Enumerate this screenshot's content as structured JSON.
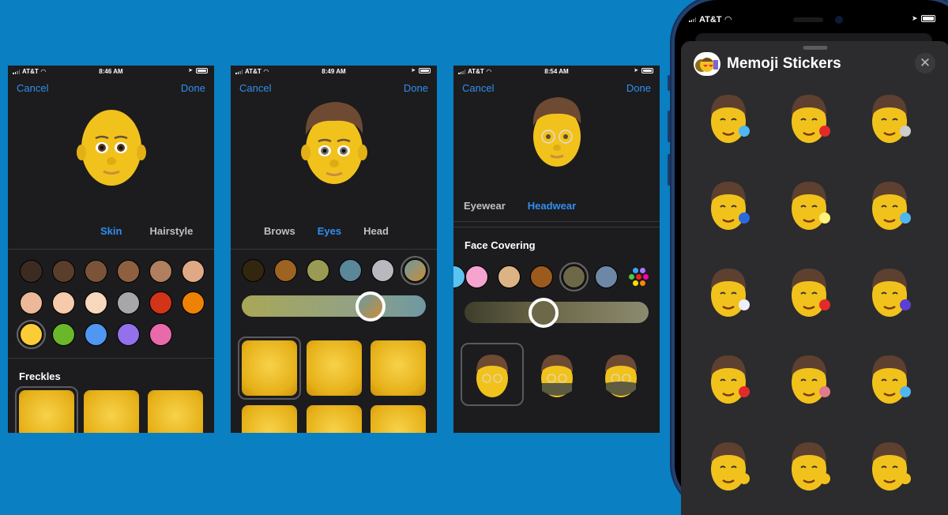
{
  "colors": {
    "background": "#0a7fc2",
    "accent": "#2f8ff0",
    "panel": "#1c1c1e",
    "sheet": "#2c2c2e"
  },
  "screens": [
    {
      "status": {
        "carrier": "AT&T",
        "time": "8:46 AM"
      },
      "nav": {
        "cancel": "Cancel",
        "done": "Done"
      },
      "avatar": "bald-memoji-face",
      "tabs": [
        {
          "label": "Skin",
          "active": true
        },
        {
          "label": "Hairstyle",
          "active": false
        }
      ],
      "swatches": [
        "#3d2b22",
        "#5b3d2c",
        "#7a5338",
        "#8e6040",
        "#b07f5e",
        "#dfa985",
        "#ebb998",
        "#f5cbab",
        "#f7d8bd",
        "#a7a7a7",
        "#d13418",
        "#ee8205",
        "#fbcc35",
        "#6ab72a",
        "#4f97f3",
        "#9470ea",
        "#e86aaa"
      ],
      "selected_swatch": 12,
      "section": "Freckles",
      "options": [
        "no-freckles",
        "light-freckles",
        "heavy-freckles"
      ],
      "selected_option": 0
    },
    {
      "status": {
        "carrier": "AT&T",
        "time": "8:49 AM"
      },
      "nav": {
        "cancel": "Cancel",
        "done": "Done"
      },
      "avatar": "memoji-with-hair-freckles",
      "tabs": [
        {
          "label": "Brows",
          "active": false
        },
        {
          "label": "Eyes",
          "active": true
        },
        {
          "label": "Head",
          "active": false
        }
      ],
      "swatches": [
        "#33260e",
        "#9c6322",
        "#999a53",
        "#5a8799",
        "#b8b9be",
        "gradient-teal-orange"
      ],
      "selected_swatch": 5,
      "slider_value": 0.7,
      "options": [
        "round-eyes",
        "almond-eyes",
        "narrow-eyes",
        "eyes-4",
        "eyes-5",
        "eyes-6"
      ],
      "selected_option": 0
    },
    {
      "status": {
        "carrier": "AT&T",
        "time": "8:54 AM"
      },
      "nav": {
        "cancel": "Cancel",
        "done": "Done"
      },
      "avatar": "memoji-with-glasses",
      "tabs": [
        {
          "label": "Eyewear",
          "active": false
        },
        {
          "label": "Headwear",
          "active": true
        }
      ],
      "section": "Face Covering",
      "swatches": [
        "#f5a3cf",
        "#dcb385",
        "#9b5a1e",
        "#6c6848",
        "#6d88a6",
        "multicolor-picker"
      ],
      "selected_swatch": 3,
      "slider_value": 0.43,
      "options": [
        "no-face-covering",
        "surgical-mask",
        "cloth-mask"
      ],
      "selected_option": 0
    }
  ],
  "phone": {
    "status": {
      "carrier": "AT&T"
    },
    "sheet_title": "Memoji Stickers",
    "close_label": "✕",
    "stickers": [
      "tears-of-joy",
      "heart-eyes",
      "mind-blown",
      "sleeping",
      "star-struck",
      "sad-tear",
      "steam-from-nose",
      "smiling-with-hearts",
      "party",
      "kiss-heart",
      "winking-tongue",
      "sweat-smile",
      "thumbs-up",
      "thumbs-down",
      "peace-sign"
    ]
  }
}
